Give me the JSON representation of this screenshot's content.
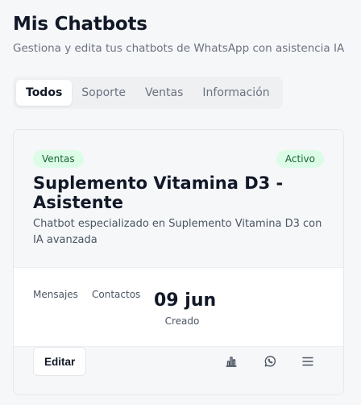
{
  "header": {
    "title": "Mis Chatbots",
    "subtitle": "Gestiona y edita tus chatbots de WhatsApp con asistencia IA"
  },
  "tabs": [
    {
      "label": "Todos",
      "active": true
    },
    {
      "label": "Soporte",
      "active": false
    },
    {
      "label": "Ventas",
      "active": false
    },
    {
      "label": "Información",
      "active": false
    }
  ],
  "card": {
    "category": "Ventas",
    "status": "Activo",
    "title": "Suplemento Vitamina D3 - Asistente",
    "description": "Chatbot especializado en Suplemento Vitamina D3 con IA avanzada",
    "stats": {
      "messages_label": "Mensajes",
      "contacts_label": "Contactos",
      "created_value": "09 jun",
      "created_label": "Creado"
    },
    "actions": {
      "edit_label": "Editar",
      "icons": [
        "bar-chart-icon",
        "whatsapp-icon",
        "menu-icon"
      ]
    }
  },
  "colors": {
    "background": "#f6f7f9",
    "badge_bg": "#dcfce7",
    "badge_text": "#166534",
    "muted_text": "#6b7280"
  }
}
